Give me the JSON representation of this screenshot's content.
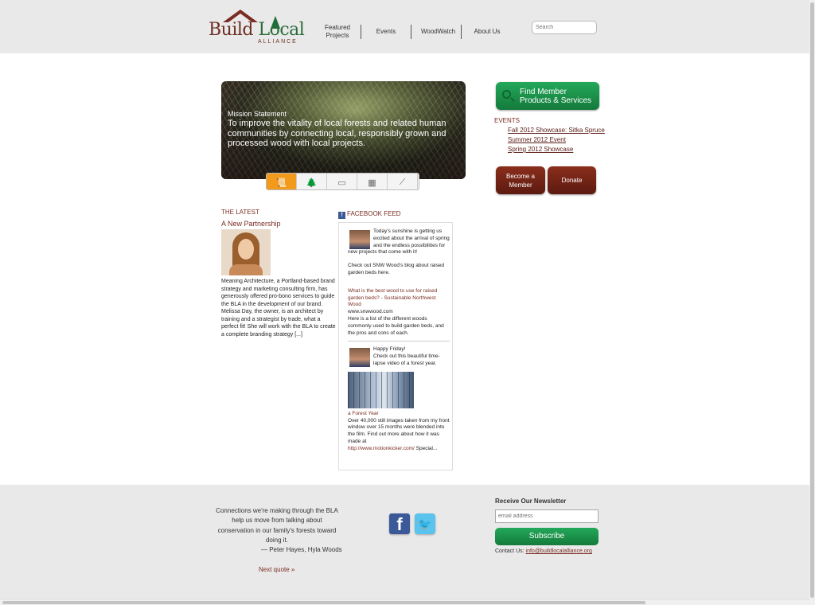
{
  "header": {
    "logo": {
      "word1": "Build",
      "word2": "Local",
      "sub": "ALLIANCE"
    },
    "nav": [
      {
        "label": "Featured Projects"
      },
      {
        "label": "Events"
      },
      {
        "label": "WoodWatch"
      },
      {
        "label": "About Us"
      }
    ],
    "search_placeholder": "Search"
  },
  "hero": {
    "title": "Mission Statement",
    "text": "To improve the vitality of local forests and related human communities by connecting local, responsibly grown and processed wood with local projects.",
    "steps": [
      {
        "icon": "scroll-icon",
        "glyph": "📜"
      },
      {
        "icon": "tree-icon",
        "glyph": "🌲"
      },
      {
        "icon": "lumber-icon",
        "glyph": "▭"
      },
      {
        "icon": "house-frame-icon",
        "glyph": "▦"
      },
      {
        "icon": "saw-icon",
        "glyph": "⟋"
      }
    ]
  },
  "sidebar": {
    "find_button": "Find Member Products & Services",
    "events_title": "EVENTS",
    "events": [
      "Fall 2012 Showcase: Sitka Spruce",
      "Summer 2012 Event",
      "Spring 2012 Showcase"
    ],
    "become_member": "Become a Member",
    "donate": "Donate"
  },
  "latest": {
    "title": "THE LATEST",
    "headline": "A New Partnership",
    "body": "Meaning Architecture, a Portland-based brand strategy and marketing consulting firm, has generously offered pro-bono services to guide the BLA in the development of our brand. Melissa Day, the owner, is an architect by training and a strategist by trade, what a perfect fit! She will work with the BLA to create a complete branding strategy [...]"
  },
  "facebook": {
    "title": "FACEBOOK FEED",
    "post1_text": "Today's sunshine is getting us excited about the arrival of spring and the endless possibilities for new projects that come with it!",
    "post1_text2": "Check out SNW Wood's blog about raised garden beds here.",
    "post1_link": "What is the best wood to use for raised garden beds? - Sustainable Northwest Wood",
    "post1_domain": "www.snwwood.com",
    "post1_desc": "Here is a list of the different woods commonly used to build garden beds, and the pros and cons of each.",
    "post2_text": "Happy Friday!",
    "post2_text2": "Check out this beautiful time-lapse video of a forest year.",
    "post2_link": "a Forest Year",
    "post2_desc": "Over 40,000 still images taken from my front window over 15 months were blended into the film. Find out more about how it was made at",
    "post2_url": "http://www.motionkicker.com/",
    "post2_more": "Special..."
  },
  "footer": {
    "quote": "Connections we're making through the BLA help us move from talking about conservation in our family's forests toward doing it.",
    "author": "— Peter Hayes, Hyla Woods",
    "next_quote": "Next quote »",
    "newsletter_title": "Receive Our Newsletter",
    "email_placeholder": "email address",
    "subscribe": "Subscribe",
    "contact_label": "Contact Us:",
    "contact_email": "info@buildlocalalliance.org"
  }
}
